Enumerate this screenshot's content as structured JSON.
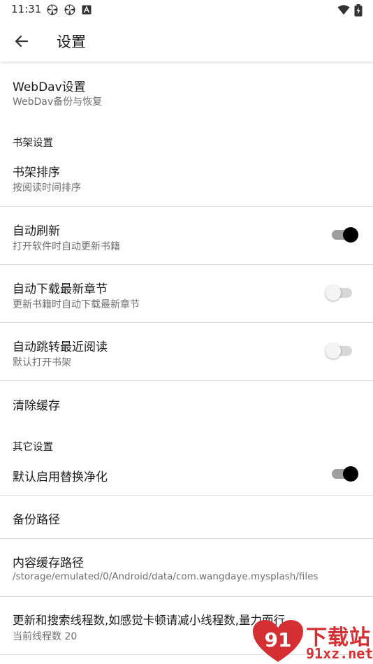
{
  "status_bar": {
    "time": "11:31",
    "icons": [
      "pinwheel-icon",
      "pinwheel-icon",
      "text-a-icon",
      "wifi-icon",
      "battery-charging-icon"
    ]
  },
  "app_bar": {
    "title": "设置",
    "back_icon": "arrow-left-icon"
  },
  "prefs": {
    "webdav": {
      "title": "WebDav设置",
      "summary": "WebDav备份与恢复"
    },
    "bookshelf_category": "书架设置",
    "bookshelf_sort": {
      "title": "书架排序",
      "summary": "按阅读时间排序"
    },
    "auto_refresh": {
      "title": "自动刷新",
      "summary": "打开软件时自动更新书籍",
      "enabled": true
    },
    "auto_download": {
      "title": "自动下载最新章节",
      "summary": "更新书籍时自动下载最新章节",
      "enabled": false
    },
    "auto_jump": {
      "title": "自动跳转最近阅读",
      "summary": "默认打开书架",
      "enabled": false
    },
    "clear_cache": {
      "title": "清除缓存"
    },
    "other_category": "其它设置",
    "replace_purify": {
      "title": "默认启用替换净化",
      "enabled": true
    },
    "backup_path": {
      "title": "备份路径"
    },
    "cache_path": {
      "title": "内容缓存路径",
      "summary": "/storage/emulated/0/Android/data/com.wangdaye.mysplash/files"
    },
    "threads": {
      "title": "更新和搜索线程数,如感觉卡顿请减小线程数,量力而行",
      "summary": "当前线程数 20"
    }
  },
  "watermark": {
    "text": "下载站",
    "url": "91xz.net",
    "logo_text": "91"
  },
  "colors": {
    "switch_on_thumb": "#000000",
    "switch_on_track": "#9e9e9e",
    "switch_off_thumb": "#f4f4f4",
    "switch_off_track": "#d7d7d7",
    "watermark_red": "#d42f33"
  }
}
